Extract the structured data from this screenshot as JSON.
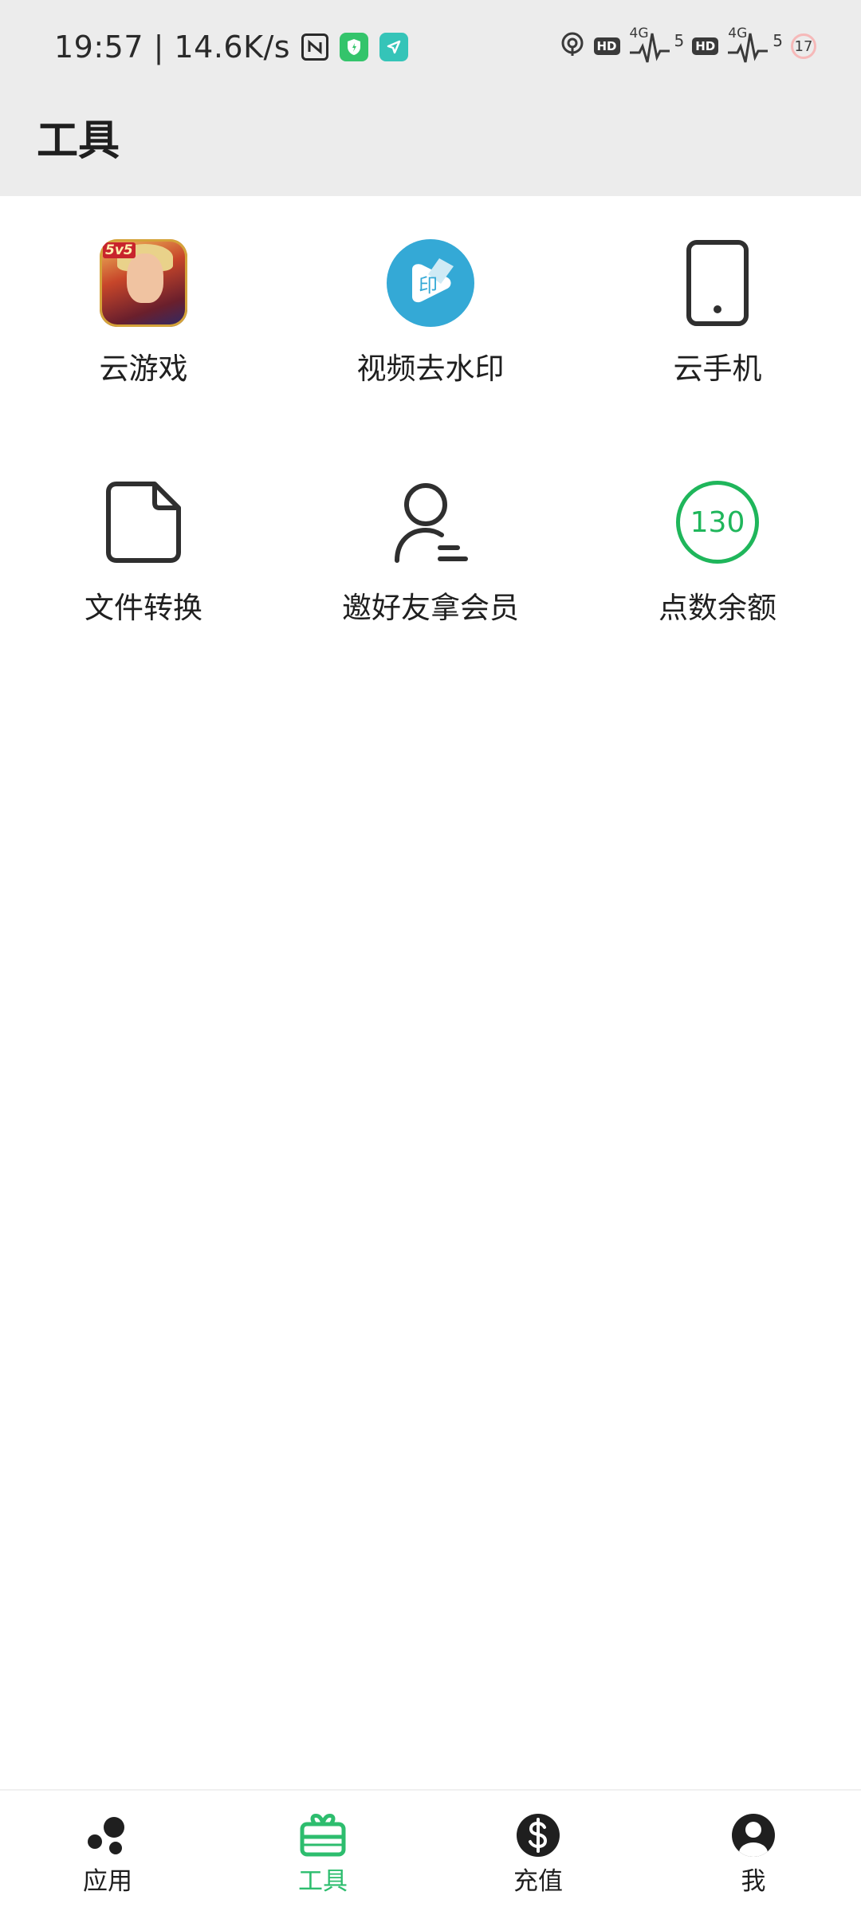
{
  "status_bar": {
    "time_speed": "19:57 | 14.6K/s",
    "hd_1": "HD",
    "hd_2": "HD",
    "net_1": "4G",
    "net_2": "4G",
    "signal_1": "5",
    "signal_2": "5",
    "battery": "17"
  },
  "header": {
    "title": "工具"
  },
  "tools": [
    {
      "label": "云游戏",
      "icon": "game-app-icon",
      "badge": "5v5"
    },
    {
      "label": "视频去水印",
      "icon": "video-watermark-icon",
      "glyph": "印"
    },
    {
      "label": "云手机",
      "icon": "phone-icon"
    },
    {
      "label": "文件转换",
      "icon": "file-icon"
    },
    {
      "label": "邀好友拿会员",
      "icon": "user-invite-icon"
    },
    {
      "label": "点数余额",
      "icon": "balance-badge-icon",
      "value": "130"
    }
  ],
  "bottom_nav": [
    {
      "label": "应用",
      "icon": "apps-dots-icon",
      "active": false
    },
    {
      "label": "工具",
      "icon": "gift-box-icon",
      "active": true
    },
    {
      "label": "充值",
      "icon": "dollar-icon",
      "active": false
    },
    {
      "label": "我",
      "icon": "user-avatar-icon",
      "active": false
    }
  ],
  "colors": {
    "accent": "#2dbd6e",
    "balance_green": "#1fb65b",
    "video_blue": "#34a9d6",
    "header_bg": "#ececec"
  }
}
